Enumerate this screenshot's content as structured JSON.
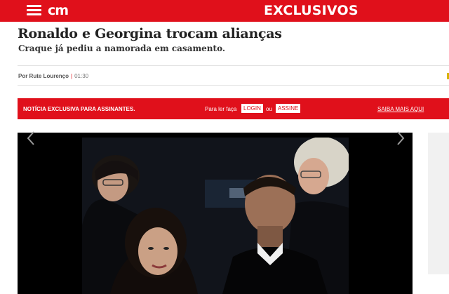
{
  "header": {
    "logo_text": "cm",
    "section": "EXCLUSIVOS",
    "brand_color": "#e0101b",
    "menu_icon": "hamburger-menu-icon"
  },
  "article": {
    "title": "Ronaldo e Georgina trocam alianças",
    "subtitle": "Craque já pediu a namorada em casamento.",
    "author": "Por Rute Lourenço",
    "separator": "|",
    "time": "01:30"
  },
  "paywall": {
    "notice": "NOTÍCIA EXCLUSIVA PARA ASSINANTES.",
    "read_prompt": "Para ler faça",
    "login_label": "LOGIN",
    "or_label": "ou",
    "subscribe_label": "ASSINE",
    "more_label": "SAIBA MAIS AQUI"
  },
  "gallery": {
    "prev_icon": "chevron-left-icon",
    "next_icon": "chevron-right-icon"
  }
}
